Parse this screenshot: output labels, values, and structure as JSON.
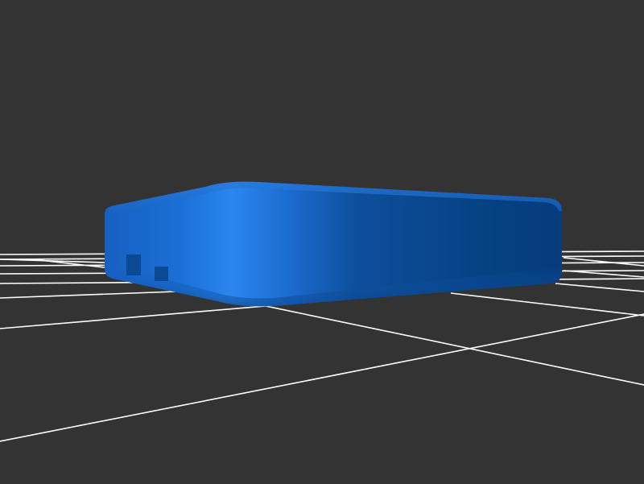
{
  "viewport": {
    "background_color": "#333333"
  },
  "grid": {
    "color": "#ffffff"
  },
  "model": {
    "shape": "rounded-rectangular-enclosure",
    "color": "#1565c0",
    "highlight_color": "#2b86ee",
    "shadow_color": "#003a7a",
    "ports": [
      "port-opening",
      "port-opening"
    ]
  }
}
